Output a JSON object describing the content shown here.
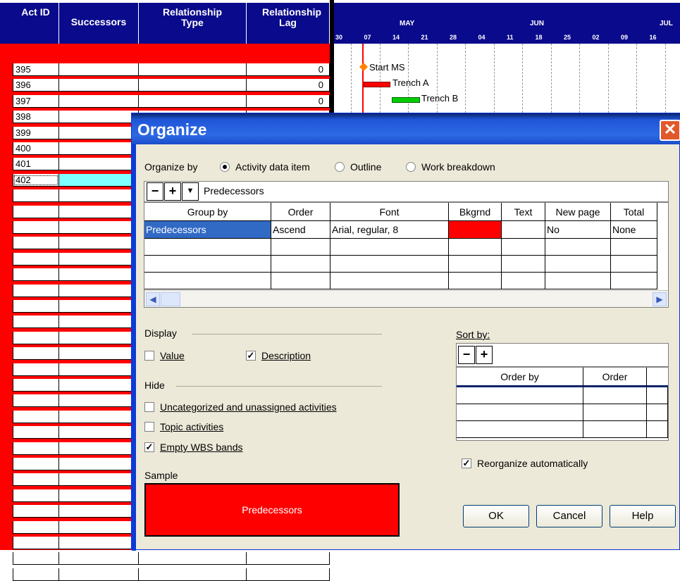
{
  "grid": {
    "headers": [
      "Act ID",
      "Successors",
      "Relationship Type",
      "Relationship Lag"
    ],
    "rows": [
      {
        "id": "395",
        "lag": "0"
      },
      {
        "id": "396",
        "lag": "0"
      },
      {
        "id": "397",
        "lag": "0"
      },
      {
        "id": "398",
        "lag": ""
      },
      {
        "id": "399",
        "lag": ""
      },
      {
        "id": "400",
        "lag": ""
      },
      {
        "id": "401",
        "lag": ""
      },
      {
        "id": "402",
        "lag": ""
      }
    ],
    "empty_row_count": 25,
    "band_color": "#ff0000",
    "selected_color": "#80ffff"
  },
  "gantt": {
    "months": [
      "MAY",
      "JUN",
      "JUL"
    ],
    "days": [
      "30",
      "07",
      "14",
      "21",
      "28",
      "04",
      "11",
      "18",
      "25",
      "02",
      "09",
      "16"
    ],
    "bars": [
      {
        "label": "Start MS",
        "type": "milestone",
        "color": "#ff8000"
      },
      {
        "label": "Trench A",
        "type": "bar",
        "color": "#ff0000"
      },
      {
        "label": "Trench B",
        "type": "bar",
        "color": "#00cc00"
      }
    ]
  },
  "dialog": {
    "title": "Organize",
    "close_icon": "close-icon",
    "organize_by_label": "Organize by",
    "options": [
      "Activity data item",
      "Outline",
      "Work breakdown"
    ],
    "selected_option": "Activity data item",
    "group_field": "Predecessors",
    "group_table": {
      "headers": [
        "Group by",
        "Order",
        "Font",
        "Bkgrnd",
        "Text",
        "New page",
        "Total"
      ],
      "row": {
        "group_by": "Predecessors",
        "order": "Ascend",
        "font": "Arial, regular, 8",
        "bkgrnd": "#ff0000",
        "text": "",
        "new_page": "No",
        "total": "None"
      }
    },
    "display": {
      "heading": "Display",
      "value_label": "Value",
      "value_checked": false,
      "description_label": "Description",
      "description_checked": true
    },
    "hide": {
      "heading": "Hide",
      "items": [
        {
          "label": "Uncategorized and unassigned activities",
          "checked": false
        },
        {
          "label": "Topic activities",
          "checked": false
        },
        {
          "label": "Empty WBS bands",
          "checked": true
        }
      ]
    },
    "sample": {
      "heading": "Sample",
      "text": "Predecessors",
      "color": "#ff0000"
    },
    "sort": {
      "label": "Sort by:",
      "headers": [
        "Order by",
        "Order"
      ]
    },
    "reorganize": {
      "label": "Reorganize automatically",
      "checked": true
    },
    "buttons": {
      "ok": "OK",
      "cancel": "Cancel",
      "help": "Help"
    }
  }
}
